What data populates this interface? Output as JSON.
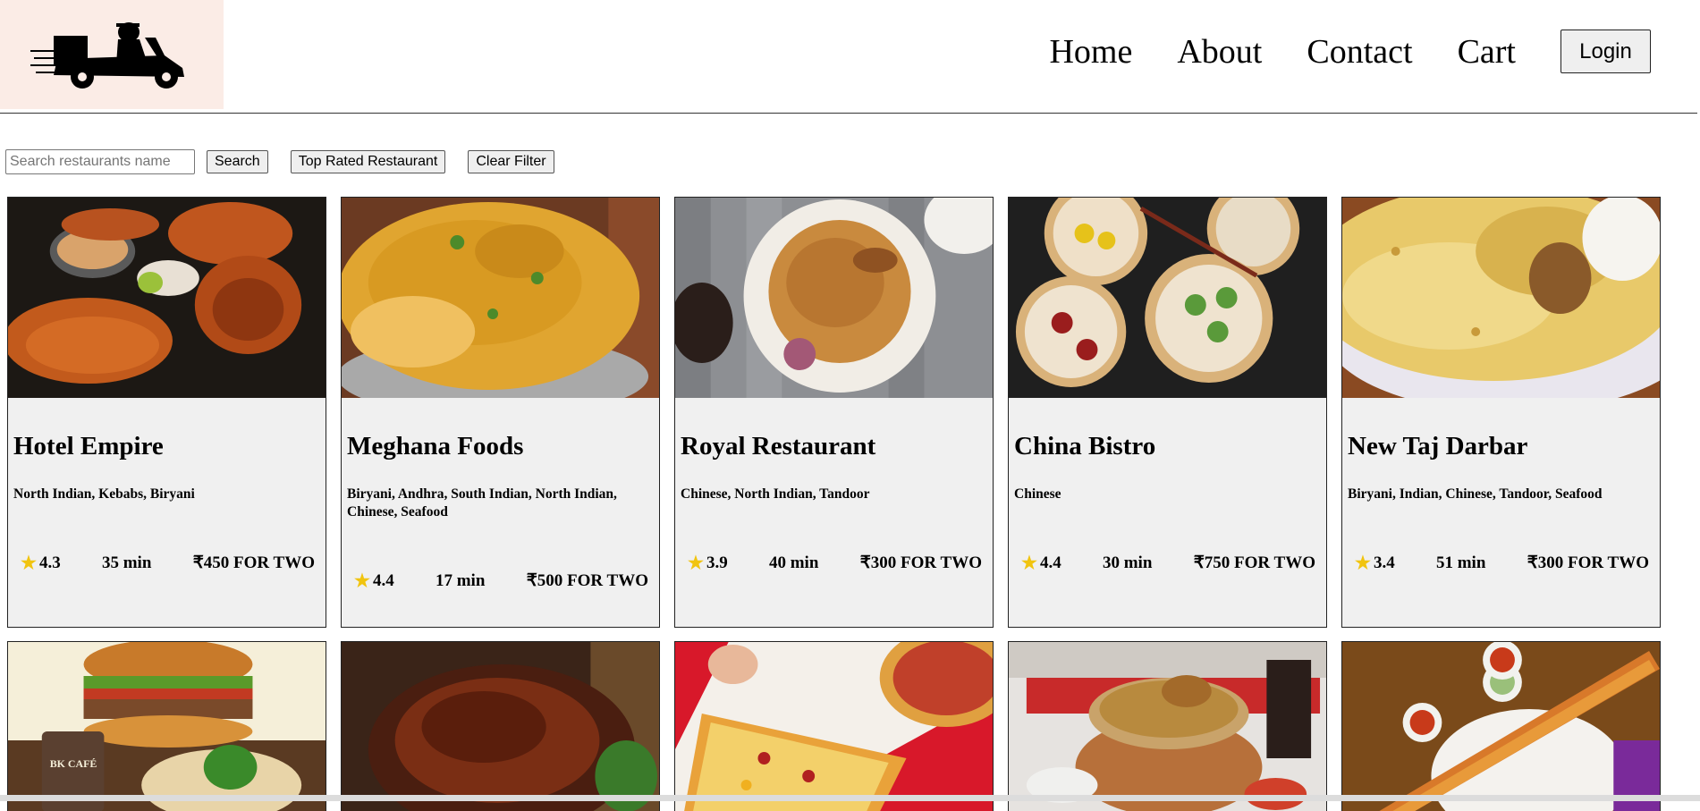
{
  "nav": {
    "links": [
      "Home",
      "About",
      "Contact",
      "Cart"
    ],
    "login_label": "Login"
  },
  "filters": {
    "search_placeholder": "Search restaurants name",
    "search_value": "",
    "search_label": "Search",
    "top_rated_label": "Top Rated Restaurant",
    "clear_label": "Clear Filter"
  },
  "restaurants": [
    {
      "name": "Hotel Empire",
      "cuisines": "North Indian, Kebabs, Biryani",
      "rating": "4.3",
      "time": "35 min",
      "cost": "₹450 FOR TWO"
    },
    {
      "name": "Meghana Foods",
      "cuisines": "Biryani, Andhra, South Indian, North Indian, Chinese, Seafood",
      "rating": "4.4",
      "time": "17 min",
      "cost": "₹500 FOR TWO"
    },
    {
      "name": "Royal Restaurant",
      "cuisines": "Chinese, North Indian, Tandoor",
      "rating": "3.9",
      "time": "40 min",
      "cost": "₹300 FOR TWO"
    },
    {
      "name": "China Bistro",
      "cuisines": "Chinese",
      "rating": "4.4",
      "time": "30 min",
      "cost": "₹750 FOR TWO"
    },
    {
      "name": "New Taj Darbar",
      "cuisines": "Biryani, Indian, Chinese, Tandoor, Seafood",
      "rating": "3.4",
      "time": "51 min",
      "cost": "₹300 FOR TWO"
    }
  ],
  "row2_image_text": "BK CAFÉ",
  "colors": {
    "logo_bg": "#fbece6",
    "card_bg": "#f0f0f0",
    "star": "#f1c40f"
  }
}
